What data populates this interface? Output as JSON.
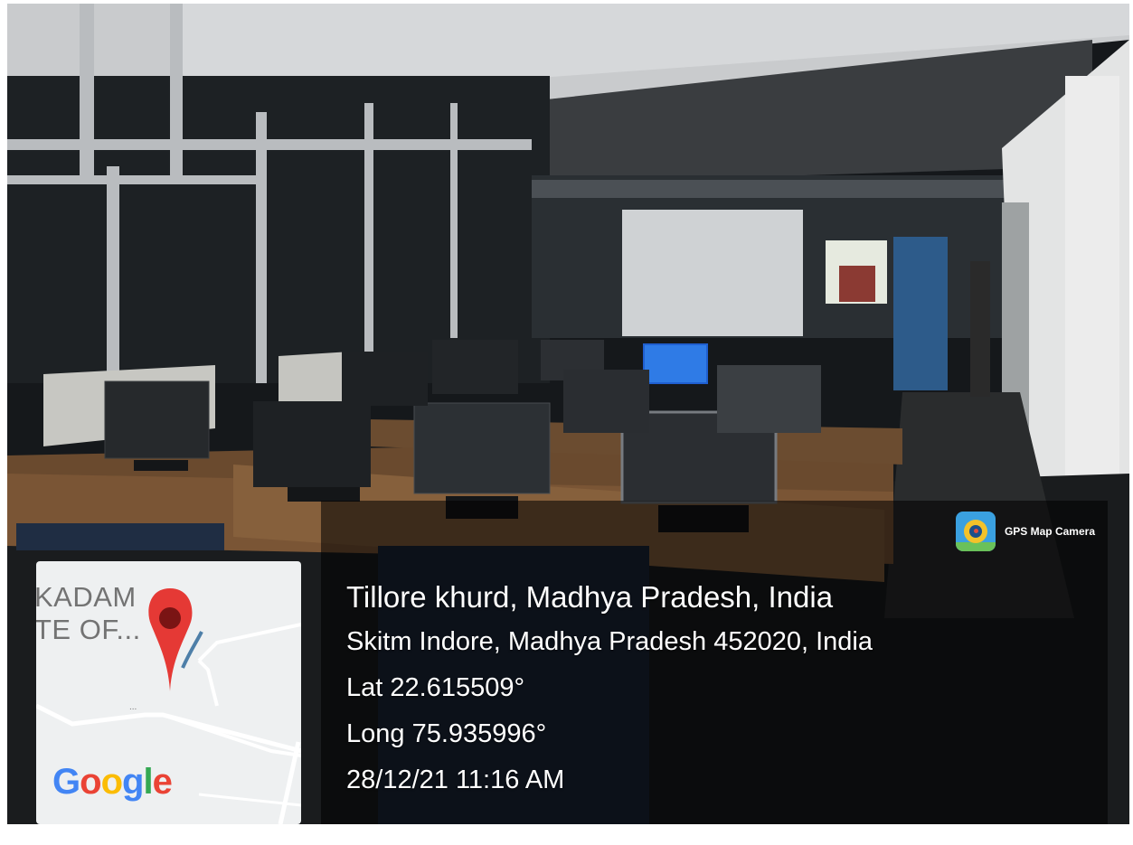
{
  "photo": {
    "description_icon": "computer-lab-photo"
  },
  "gps_stamp": {
    "app_name": "GPS Map Camera",
    "app_icon": "camera-lens-icon",
    "location_title": "Tillore khurd, Madhya Pradesh, India",
    "address": "Skitm Indore, Madhya Pradesh 452020, India",
    "latitude": "Lat 22.615509°",
    "longitude": "Long 75.935996°",
    "datetime": "28/12/21 11:16 AM"
  },
  "map": {
    "place_label_line_1": "KADAM",
    "place_label_line_2": "TE OF...",
    "more_label": "...",
    "provider_logo_letters": [
      "G",
      "o",
      "o",
      "g",
      "l",
      "e"
    ],
    "pin_icon": "map-pin-icon",
    "pin_color": "#e53935"
  }
}
